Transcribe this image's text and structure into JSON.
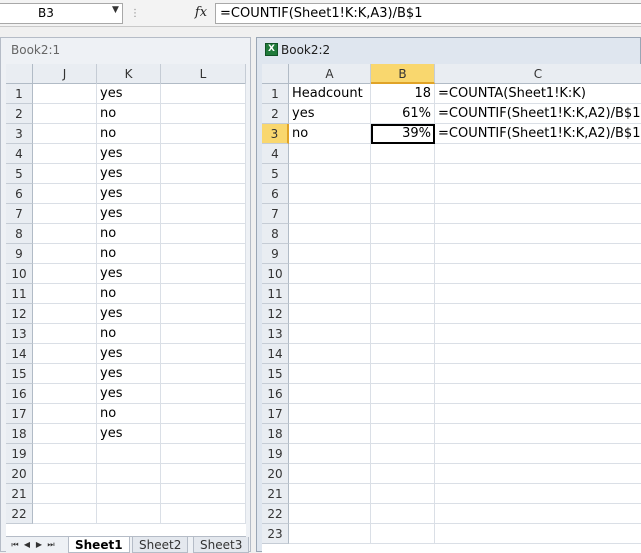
{
  "formula_bar": {
    "name_box": "B3",
    "fx": "fx",
    "formula": "=COUNTIF(Sheet1!K:K,A3)/B$1"
  },
  "window1": {
    "title": "Book2:1",
    "columns": [
      "J",
      "K",
      "L"
    ],
    "rows": [
      "1",
      "2",
      "3",
      "4",
      "5",
      "6",
      "7",
      "8",
      "9",
      "10",
      "11",
      "12",
      "13",
      "14",
      "15",
      "16",
      "17",
      "18",
      "19",
      "20",
      "21",
      "22"
    ],
    "k_values": [
      "yes",
      "no",
      "no",
      "yes",
      "yes",
      "yes",
      "yes",
      "no",
      "no",
      "yes",
      "no",
      "yes",
      "no",
      "yes",
      "yes",
      "yes",
      "no",
      "yes"
    ],
    "tabs": [
      "Sheet1",
      "Sheet2",
      "Sheet3"
    ],
    "active_tab": "Sheet1"
  },
  "window2": {
    "title": "Book2:2",
    "columns": [
      "A",
      "B",
      "C"
    ],
    "rows": [
      "1",
      "2",
      "3",
      "4",
      "5",
      "6",
      "7",
      "8",
      "9",
      "10",
      "11",
      "12",
      "13",
      "14",
      "15",
      "16",
      "17",
      "18",
      "19",
      "20",
      "21",
      "22",
      "23"
    ],
    "cells": [
      {
        "a": "Headcount",
        "b": "18",
        "c": "=COUNTA(Sheet1!K:K)"
      },
      {
        "a": "yes",
        "b": "61%",
        "c": "=COUNTIF(Sheet1!K:K,A2)/B$1"
      },
      {
        "a": "no",
        "b": "39%",
        "c": "=COUNTIF(Sheet1!K:K,A2)/B$1"
      }
    ],
    "selected": "B3"
  }
}
